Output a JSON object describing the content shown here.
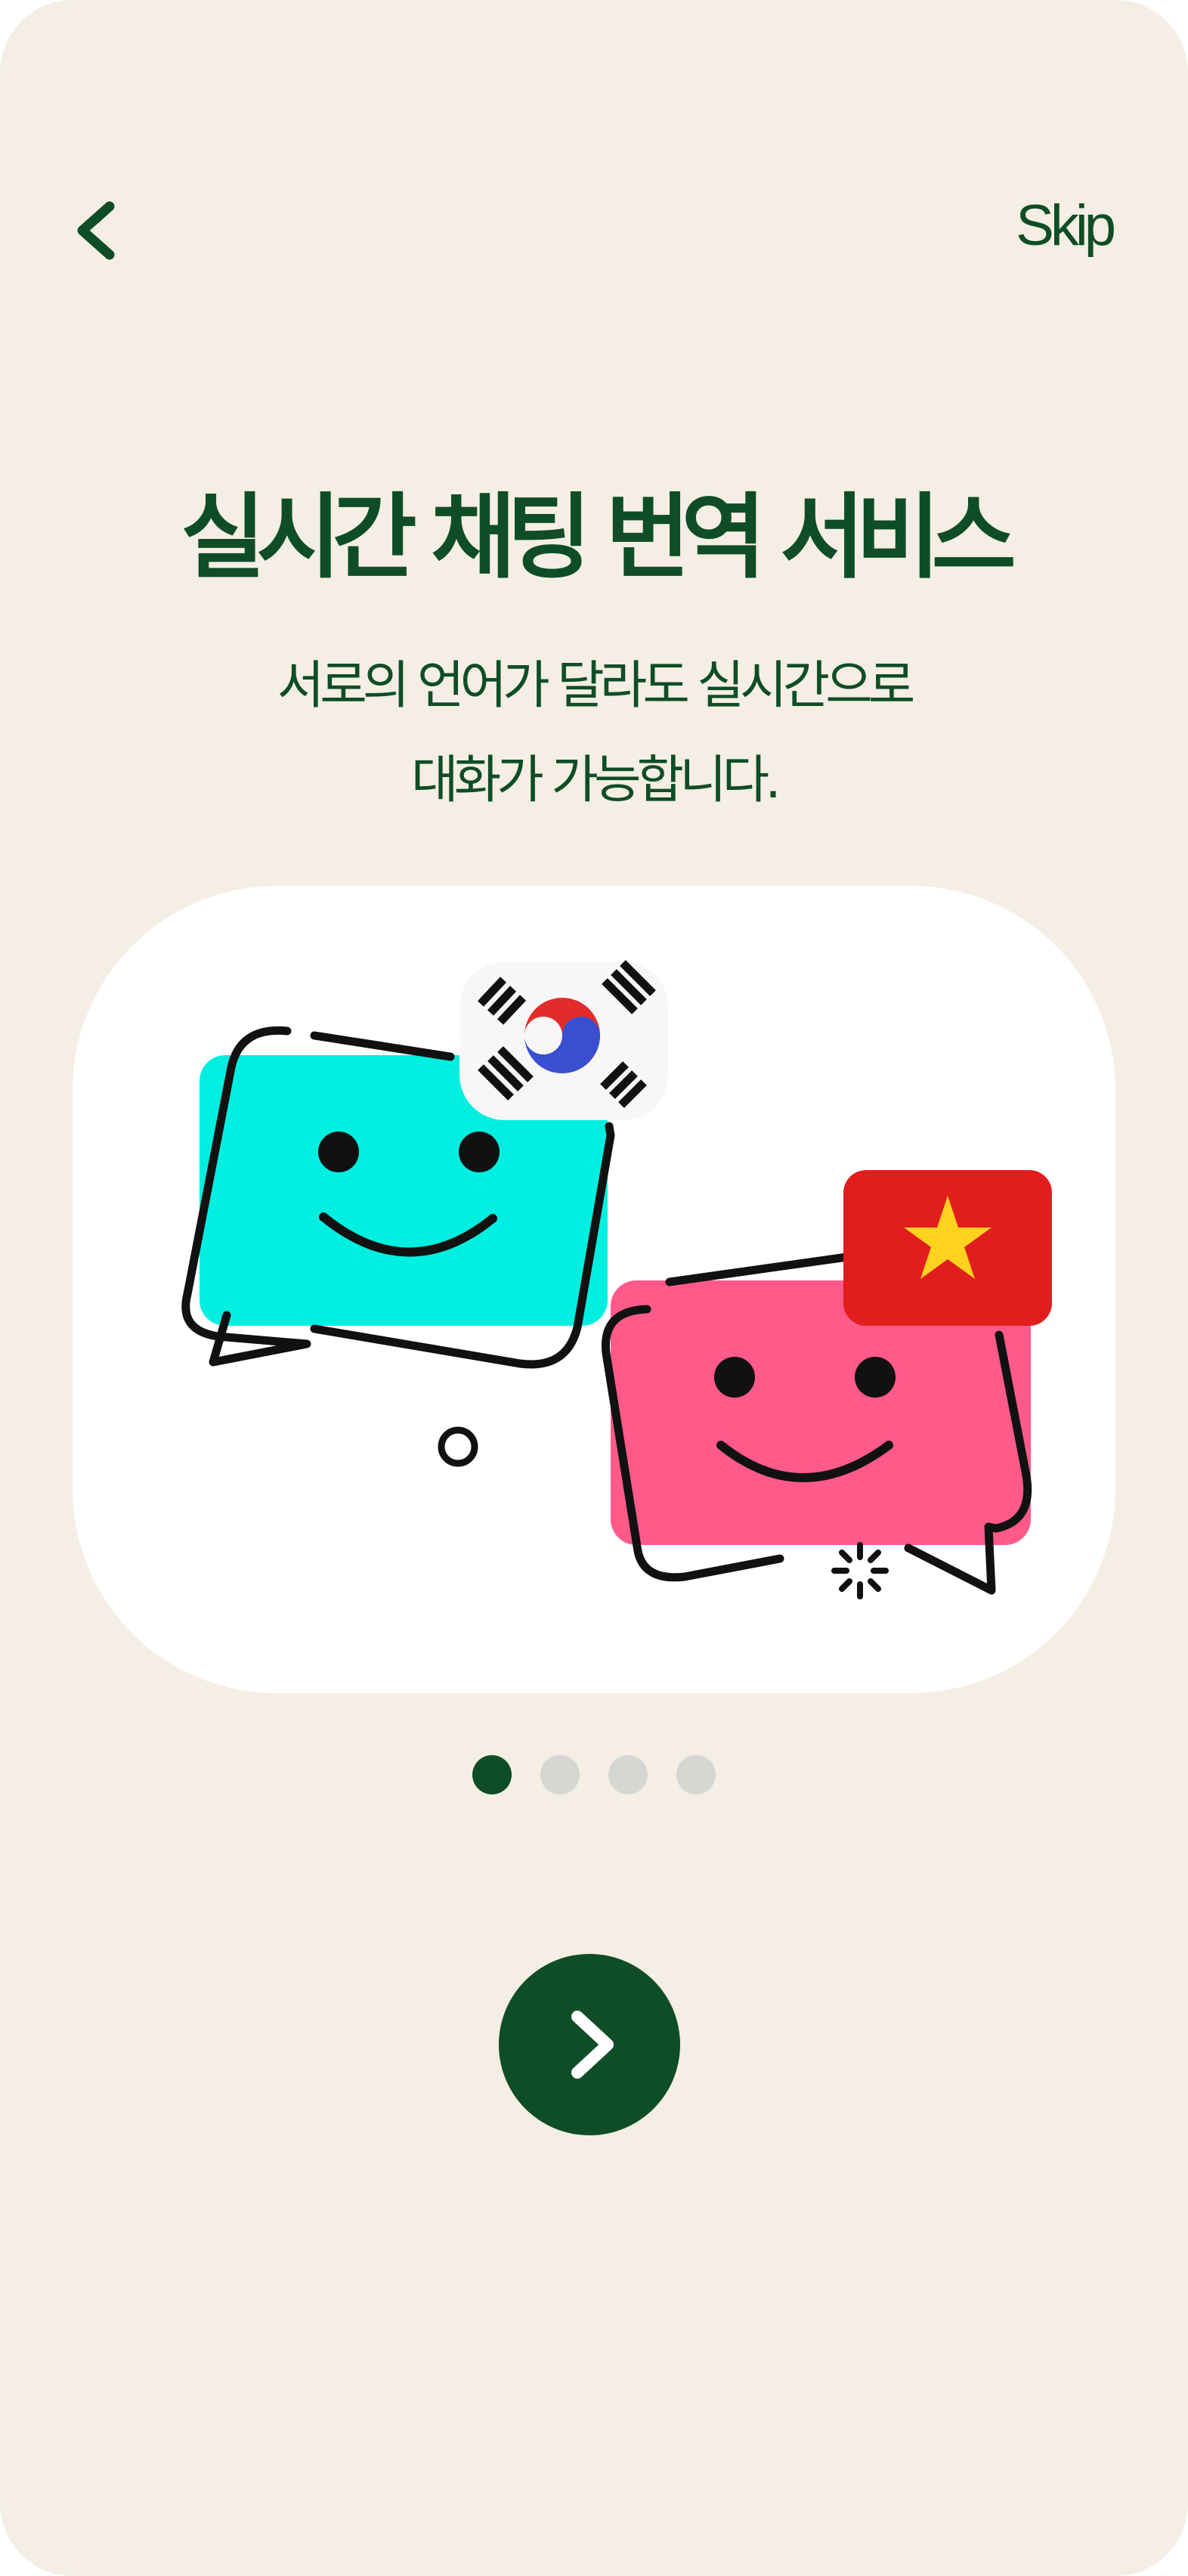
{
  "header": {
    "back_icon": "chevron-left-icon",
    "skip_label": "Skip"
  },
  "main": {
    "title": "실시간 채팅 번역 서비스",
    "subtitle_line1": "서로의 언어가 달라도 실시간으로",
    "subtitle_line2": "대화가 가능합니다."
  },
  "illustration": {
    "left_bubble_color": "#00efe0",
    "right_bubble_color": "#ff5a8a",
    "flags": [
      "south-korea-flag",
      "vietnam-flag"
    ]
  },
  "pager": {
    "total": 4,
    "active_index": 0
  },
  "next_button": {
    "icon": "chevron-right-icon"
  },
  "colors": {
    "background": "#f4eee5",
    "primary": "#0f4d26",
    "inactive_dot": "#d6d6d3"
  }
}
